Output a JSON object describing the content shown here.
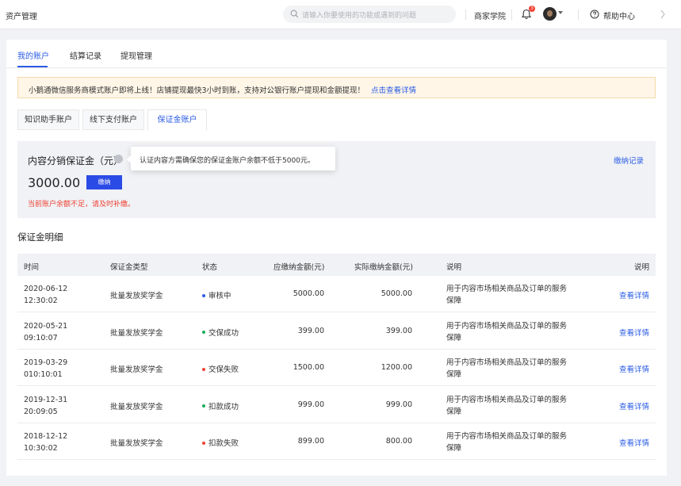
{
  "topbar": {
    "title": "资产管理",
    "search_placeholder": "请输入你要使用的功能或遇到的问题",
    "merchant_academy": "商家学院",
    "bell_badge": "3",
    "help_center": "帮助中心"
  },
  "tabs": [
    {
      "label": "我的账户",
      "active": true
    },
    {
      "label": "结算记录",
      "active": false
    },
    {
      "label": "提现管理",
      "active": false
    }
  ],
  "notice": {
    "text": "小鹅通微信服务商模式账户即将上线！店铺提现最快3小时到账，支持对公银行账户提现和金额提现！",
    "link": "点击查看详情"
  },
  "subtabs": [
    {
      "label": "知识助手账户",
      "active": false
    },
    {
      "label": "线下支付账户",
      "active": false
    },
    {
      "label": "保证金账户",
      "active": true
    }
  ],
  "deposit": {
    "title": "内容分销保证金（元）",
    "tooltip": "认证内容方需确保您的保证金账户余额不低于5000元。",
    "amount": "3000.00",
    "pay_button": "缴纳",
    "warning": "当前账户余额不足，请及时补缴。",
    "record_link": "缴纳记录"
  },
  "details": {
    "section_title": "保证金明细",
    "columns": [
      "时间",
      "保证金类型",
      "状态",
      "应缴纳金额(元)",
      "实际缴纳金额(元)",
      "说明",
      "说明"
    ],
    "rows": [
      {
        "date": "2020-06-12",
        "time": "12:30:02",
        "type": "批量发放奖学金",
        "status": "审核中",
        "status_color": "#2b5ce6",
        "due": "5000.00",
        "paid": "5000.00",
        "desc": "用于内容市场相关商品及订单的服务保障",
        "action": "查看详情"
      },
      {
        "date": "2020-05-21",
        "time": "09:10:07",
        "type": "批量发放奖学金",
        "status": "交保成功",
        "status_color": "#1aad5b",
        "due": "399.00",
        "paid": "399.00",
        "desc": "用于内容市场相关商品及订单的服务保障",
        "action": "查看详情"
      },
      {
        "date": "2019-03-29",
        "time": "010:10:01",
        "type": "批量发放奖学金",
        "status": "交保失败",
        "status_color": "#f04134",
        "due": "1500.00",
        "paid": "1200.00",
        "desc": "用于内容市场相关商品及订单的服务保障",
        "action": "查看详情"
      },
      {
        "date": "2019-12-31",
        "time": "20:09:05",
        "type": "批量发放奖学金",
        "status": "扣款成功",
        "status_color": "#1aad5b",
        "due": "999.00",
        "paid": "999.00",
        "desc": "用于内容市场相关商品及订单的服务保障",
        "action": "查看详情"
      },
      {
        "date": "2018-12-12",
        "time": "10:30:02",
        "type": "批量发放奖学金",
        "status": "扣款失败",
        "status_color": "#f04134",
        "due": "899.00",
        "paid": "800.00",
        "desc": "用于内容市场相关商品及订单的服务保障",
        "action": "查看详情"
      }
    ]
  }
}
